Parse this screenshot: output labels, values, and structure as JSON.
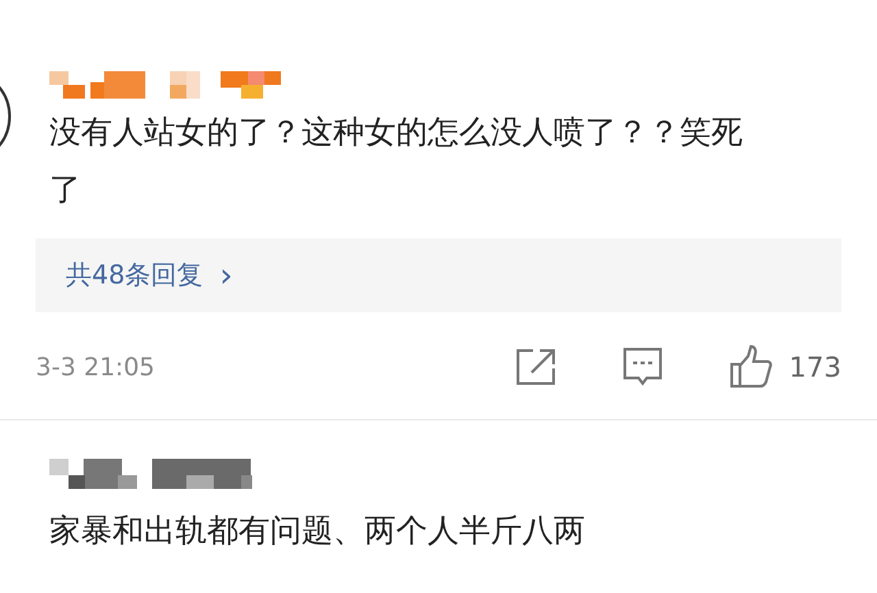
{
  "comments": [
    {
      "text": "没有人站女的了？这种女的怎么没人喷了？？笑死了",
      "replies": "共48条回复",
      "replies_arrow": "›",
      "time": "3-3 21:05",
      "likes": "173"
    },
    {
      "text": "家暴和出轨都有问题、两个人半斤八两"
    }
  ]
}
